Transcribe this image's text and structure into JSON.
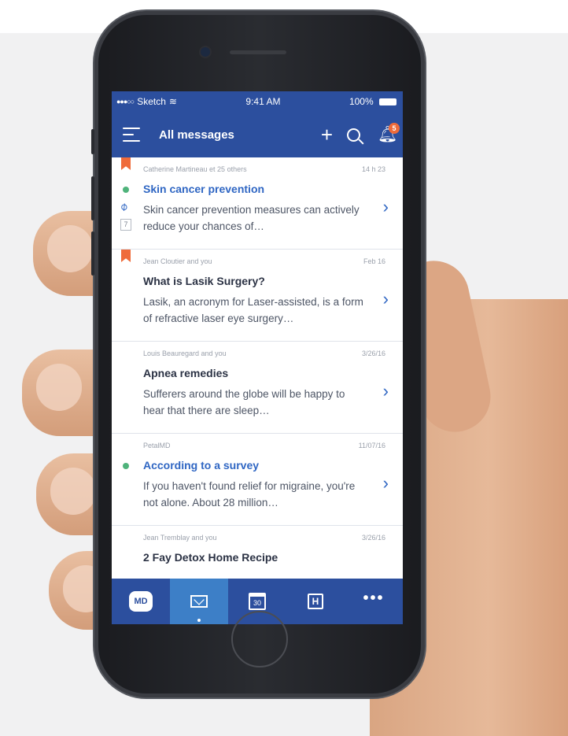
{
  "status_bar": {
    "carrier": "Sketch",
    "time": "9:41 AM",
    "battery": "100%"
  },
  "header": {
    "title": "All messages",
    "notification_count": "5"
  },
  "icons": {
    "menu": "menu-icon",
    "add": "plus-icon",
    "search": "search-icon",
    "notifications": "bell-icon",
    "attachment": "paperclip-icon",
    "chevron": "chevron-right-icon"
  },
  "colors": {
    "primary": "#2c4f9e",
    "active_tab": "#3d7fc7",
    "accent": "#2f66c3",
    "bookmark": "#ef6b3a",
    "unread_dot": "#4fb37b"
  },
  "messages": [
    {
      "from": "Catherine Martineau et 25 others",
      "date": "14 h 23",
      "subject": "Skin cancer prevention",
      "preview": "Skin cancer prevention measures can actively reduce your chances of…",
      "thread_count": "7"
    },
    {
      "from": "Jean Cloutier and you",
      "date": "Feb 16",
      "subject": "What is Lasik Surgery?",
      "preview": "Lasik, an acronym for Laser-assisted, is a form of refractive laser eye surgery…"
    },
    {
      "from": "Louis Beauregard and you",
      "date": "3/26/16",
      "subject": "Apnea remedies",
      "preview": "Sufferers around the globe will be happy to hear that there are sleep…"
    },
    {
      "from": "PetalMD",
      "date": "11/07/16",
      "subject": "According to a survey",
      "preview": "If you haven't found relief for migraine, you're not alone. About 28 million…"
    },
    {
      "from": "Jean Tremblay and you",
      "date": "3/26/16",
      "subject": "2 Fay Detox Home Recipe"
    }
  ],
  "tabs": {
    "md_label": "MD",
    "calendar_label": "30",
    "h_label": "H",
    "more_label": "•••"
  }
}
